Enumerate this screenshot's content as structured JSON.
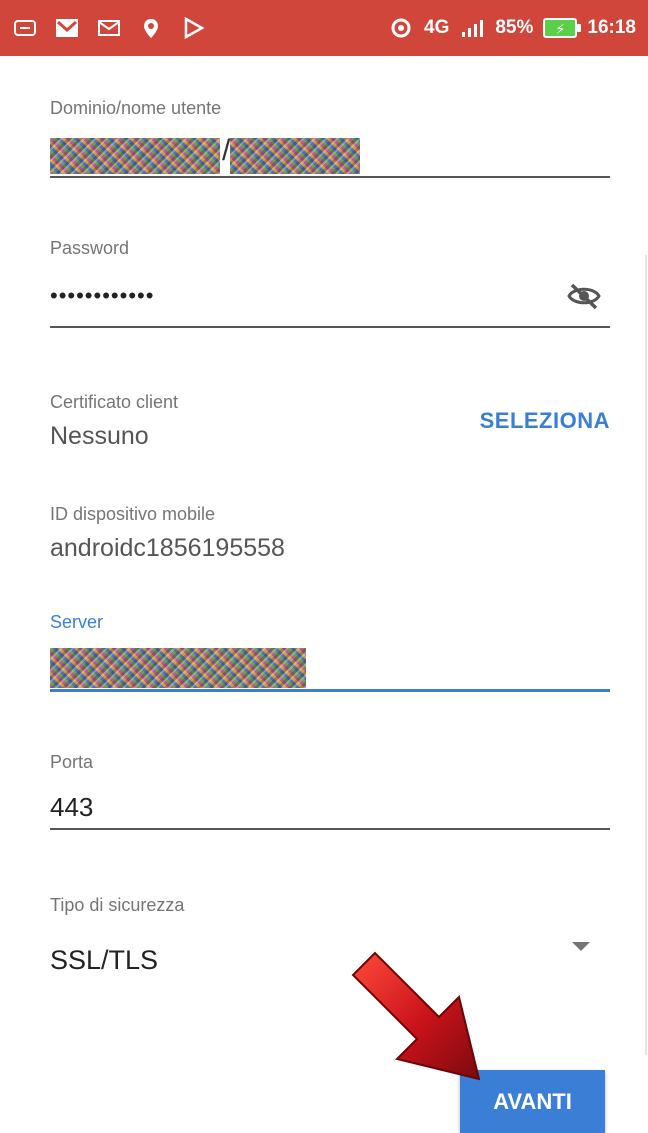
{
  "status_bar": {
    "network": "4G",
    "battery": "85%",
    "time": "16:18"
  },
  "form": {
    "username": {
      "label": "Dominio/nome utente",
      "separator": "/"
    },
    "password": {
      "label": "Password",
      "value": "••••••••••••"
    },
    "certificate": {
      "label": "Certificato client",
      "value": "Nessuno",
      "select_label": "SELEZIONA"
    },
    "device_id": {
      "label": "ID dispositivo mobile",
      "value": "androidc1856195558"
    },
    "server": {
      "label": "Server"
    },
    "port": {
      "label": "Porta",
      "value": "443"
    },
    "security": {
      "label": "Tipo di sicurezza",
      "selected": "SSL/TLS"
    }
  },
  "actions": {
    "next_label": "AVANTI"
  },
  "colors": {
    "status_bar": "#d0463a",
    "accent": "#3a7fd5",
    "arrow": "#c8121a"
  }
}
